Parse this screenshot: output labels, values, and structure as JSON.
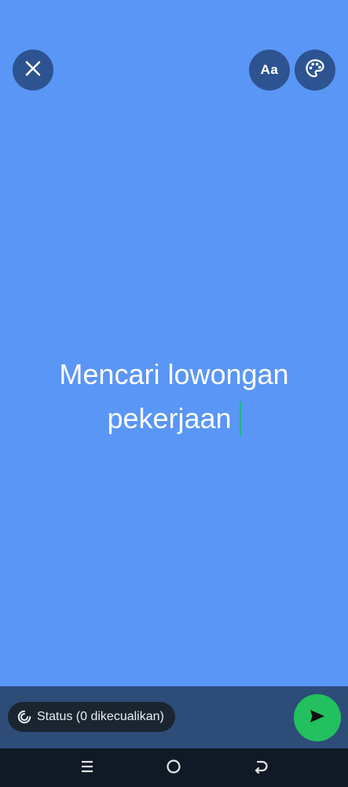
{
  "top_controls": {
    "close_icon": "close-icon",
    "font_label": "Aa",
    "palette_icon": "palette-icon"
  },
  "status_editor": {
    "text_line1": "Mencari lowongan",
    "text_line2": "pekerjaan",
    "background_color": "#5a96f5",
    "caret_color": "#1fb58a"
  },
  "bottom_bar": {
    "audience_label": "Status (0 dikecualikan)",
    "audience_icon": "status-ring-icon",
    "send_icon": "send-icon",
    "send_color": "#22c05e"
  },
  "system_nav": {
    "recents_icon": "recents-icon",
    "home_icon": "home-icon",
    "back_icon": "back-icon"
  }
}
